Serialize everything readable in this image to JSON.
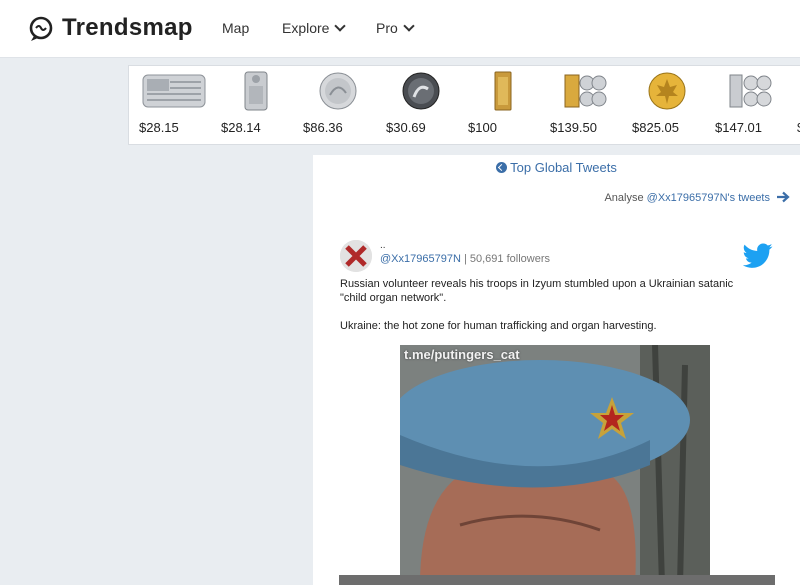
{
  "header": {
    "brand": "Trendsmap",
    "nav": [
      {
        "label": "Map",
        "has_dropdown": false
      },
      {
        "label": "Explore",
        "has_dropdown": true
      },
      {
        "label": "Pro",
        "has_dropdown": true
      }
    ]
  },
  "ad_products": [
    {
      "price": "$28.15",
      "icon": "silver-bar-flag"
    },
    {
      "price": "$28.14",
      "icon": "silver-bar"
    },
    {
      "price": "$86.36",
      "icon": "silver-coin"
    },
    {
      "price": "$30.69",
      "icon": "dark-silver-coin"
    },
    {
      "price": "$100",
      "icon": "gold-note"
    },
    {
      "price": "$139.50",
      "icon": "gold-coin-set"
    },
    {
      "price": "$825.05",
      "icon": "gold-maple-coin"
    },
    {
      "price": "$147.01",
      "icon": "silver-coin-set"
    },
    {
      "price": "$",
      "icon": "partial-item"
    }
  ],
  "panel": {
    "top_global_label": "Top Global Tweets",
    "analyse_prefix": "Analyse ",
    "analyse_handle": "@Xx17965797N's tweets"
  },
  "tweet": {
    "display_name": "..",
    "handle": "@Xx17965797N",
    "followers": "50,691 followers",
    "paragraphs": [
      "Russian volunteer reveals his troops in Izyum stumbled upon a Ukrainian satanic \"child organ network\".",
      "Ukraine: the hot zone for human trafficking and organ harvesting."
    ],
    "media_watermark": "t.me/putingers_cat"
  },
  "colors": {
    "link": "#3b6ea8",
    "twitter": "#1da1f2",
    "background": "#e9edf1"
  }
}
